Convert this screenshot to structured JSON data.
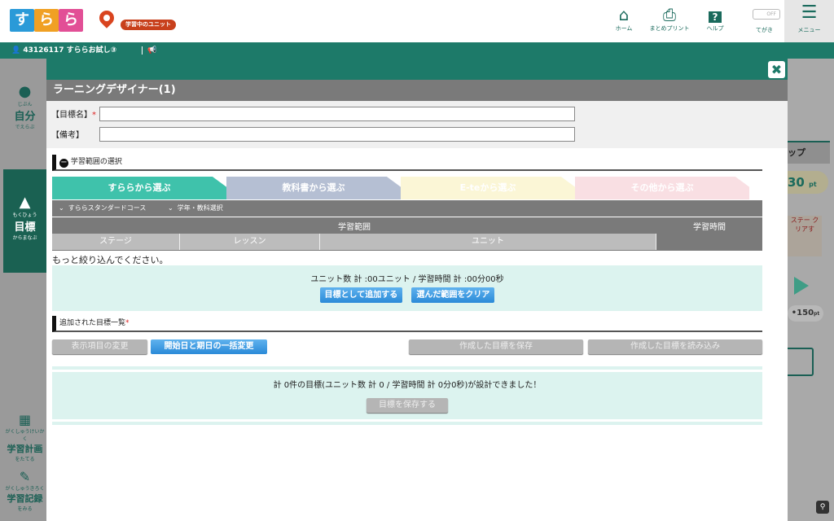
{
  "header": {
    "logo": [
      "す",
      "ら",
      "ら"
    ],
    "unit_badge": "学習中のユニット",
    "nav": [
      {
        "label": "ホーム",
        "icon": "home-icon"
      },
      {
        "label": "まとめプリント",
        "icon": "printer-icon"
      },
      {
        "label": "ヘルプ",
        "icon": "help-icon"
      }
    ],
    "toggle": {
      "state": "OFF",
      "label": "てがき"
    },
    "menu_label": "メニュー"
  },
  "userbar": {
    "user": "43126117 すららお試し③"
  },
  "sidebar": {
    "items": [
      {
        "ruby": "じぶん",
        "label": "自分",
        "sub": "でえらぶ"
      },
      {
        "ruby": "もくひょう",
        "label": "目標",
        "sub": "からまなぶ"
      },
      {
        "ruby": "がくしゅうけいかく",
        "label": "学習計画",
        "sub": "をたてる"
      },
      {
        "ruby": "がくしゅうきろく",
        "label": "学習記録",
        "sub": "をみる"
      }
    ]
  },
  "background": {
    "frag1": "ップ",
    "frag2": "30",
    "frag2_unit": "pt",
    "frag3": "ステー クリアす",
    "frag4": "•150",
    "frag4_unit": "pt"
  },
  "modal": {
    "title": "ラーニングデザイナー(1)",
    "goal_name_label": "【目標名】",
    "goal_name_value": "",
    "notes_label": "【備考】",
    "notes_value": "",
    "range_section": "学習範囲の選択",
    "tabs": [
      "すららから選ぶ",
      "教科書から選ぶ",
      "E-teから選ぶ",
      "その他から選ぶ"
    ],
    "course": "すららスタンダードコース",
    "grade_subject": "学年・教科選択",
    "table": {
      "range_header": "学習範囲",
      "time_header": "学習時間",
      "columns": [
        "ステージ",
        "レッスン",
        "ユニット"
      ]
    },
    "narrow_msg": "もっと絞り込んでください。",
    "summary": "ユニット数 計 :00ユニット / 学習時間 計 :00分00秒",
    "add_btn": "目標として追加する",
    "clear_btn": "選んだ範囲をクリア",
    "list_section": "追加された目標一覧",
    "change_display_btn": "表示項目の変更",
    "bulk_date_btn": "開始日と期日の一括変更",
    "save_created_btn": "作成した目標を保存",
    "load_created_btn": "作成した目標を読み込み",
    "result_msg": "計 0件の目標(ユニット数 計 0 / 学習時間 計 0分0秒)が設計できました！",
    "save_goal_btn": "目標を保存する"
  }
}
